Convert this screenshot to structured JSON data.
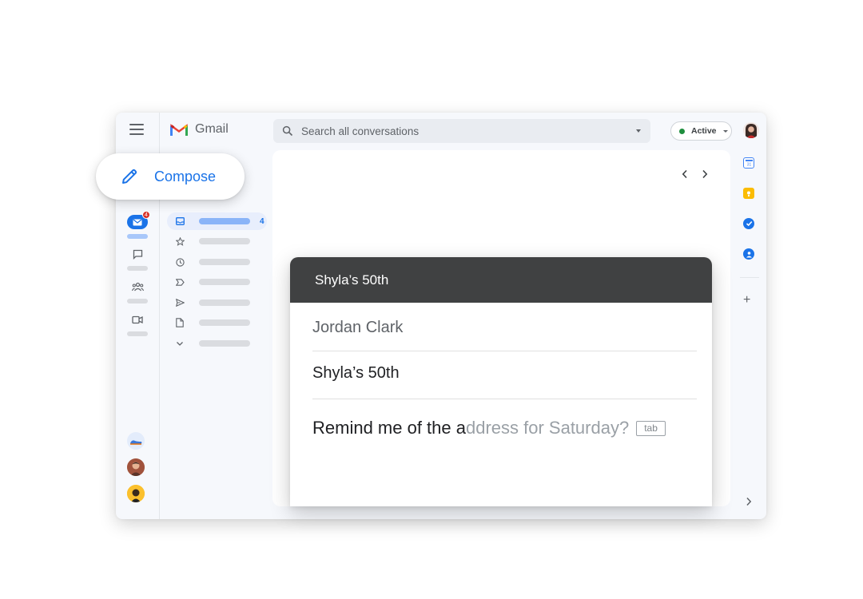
{
  "app": {
    "name": "Gmail"
  },
  "search": {
    "placeholder": "Search all conversations"
  },
  "status": {
    "label": "Active",
    "color": "#1e8e3e"
  },
  "compose": {
    "label": "Compose"
  },
  "mail": {
    "unread_badge": "4"
  },
  "nav": {
    "inbox_count": "4"
  },
  "compose_window": {
    "title": "Shyla’s 50th",
    "to": "Jordan Clark",
    "subject": "Shyla’s 50th",
    "body_typed": "Remind me of the a",
    "body_suggestion": "ddress for Saturday?",
    "accept_key": "tab"
  },
  "colors": {
    "accent": "#1a73e8",
    "compose_header": "#404142",
    "frame_bg": "#f6f8fc"
  }
}
